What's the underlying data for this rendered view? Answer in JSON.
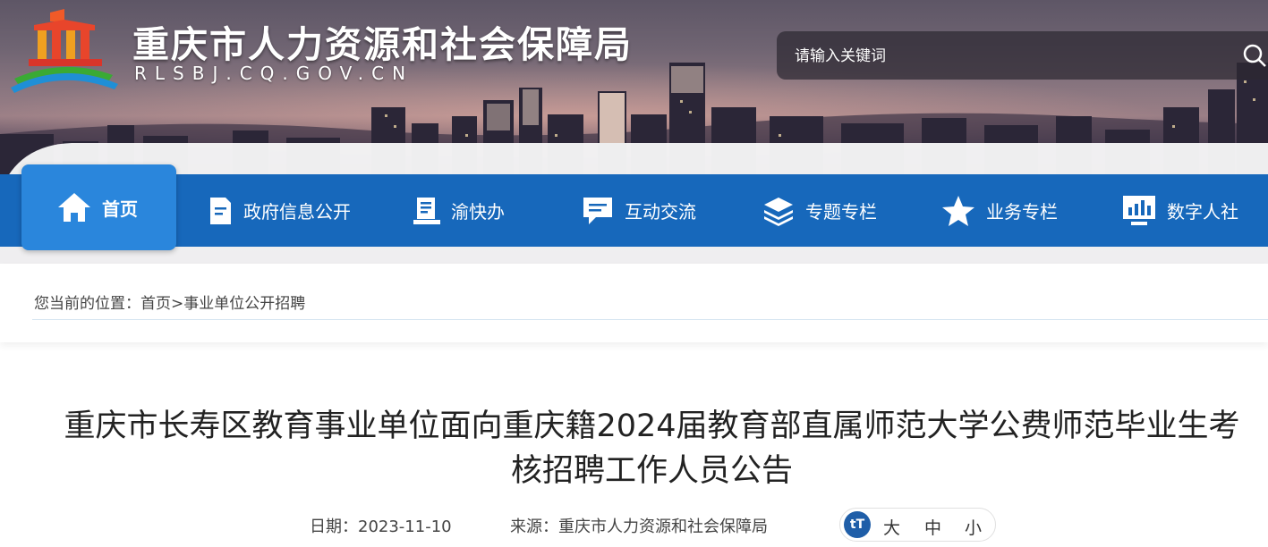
{
  "site": {
    "title": "重庆市人力资源和社会保障局",
    "domain": "RLSBJ.CQ.GOV.CN"
  },
  "search": {
    "placeholder": "请输入关键词"
  },
  "nav": {
    "items": [
      {
        "label": "首页",
        "icon": "home-icon"
      },
      {
        "label": "政府信息公开",
        "icon": "document-icon"
      },
      {
        "label": "渝快办",
        "icon": "clipboard-icon"
      },
      {
        "label": "互动交流",
        "icon": "chat-icon"
      },
      {
        "label": "专题专栏",
        "icon": "layers-icon"
      },
      {
        "label": "业务专栏",
        "icon": "star-icon"
      },
      {
        "label": "数字人社",
        "icon": "monitor-chart-icon"
      }
    ]
  },
  "breadcrumb": {
    "prefix": "您当前的位置：",
    "home": "首页",
    "separator": ">",
    "current": "事业单位公开招聘"
  },
  "article": {
    "title_line1": "重庆市长寿区教育事业单位面向重庆籍2024届教育部直属师范大学公费师范毕业生考",
    "title_line2": "核招聘工作人员公告",
    "date_label": "日期：",
    "date": "2023-11-10",
    "source_label": "来源：",
    "source": "重庆市人力资源和社会保障局"
  },
  "font_size": {
    "icon_text": "tT",
    "large": "大",
    "medium": "中",
    "small": "小"
  },
  "colors": {
    "nav_bg": "#1768bb",
    "nav_active": "#2a86dc",
    "font_icon_bg": "#1f5ea8"
  }
}
